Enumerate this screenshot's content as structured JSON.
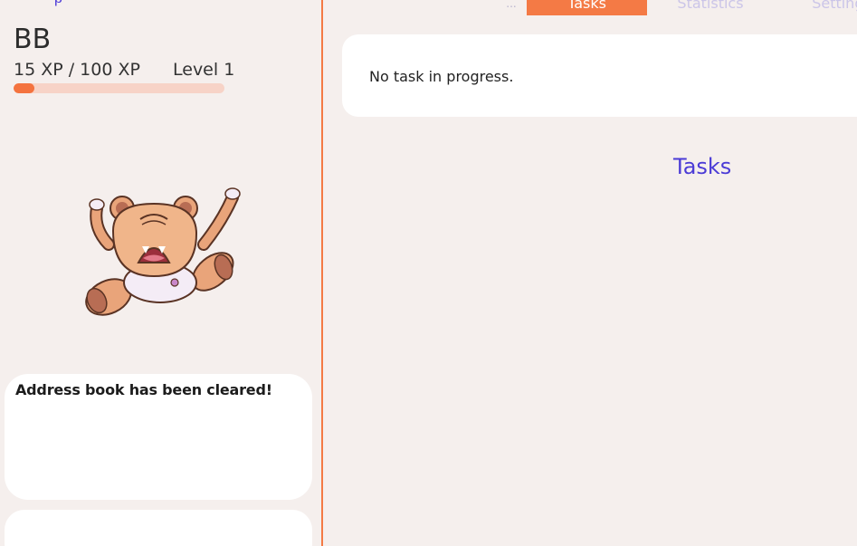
{
  "left_panel": {
    "top_clipped_text": "p",
    "pet_name": "BB",
    "xp_text": "15 XP / 100 XP",
    "level_text": "Level 1",
    "xp_progress": 0.1,
    "pet_image": "angry-bear-icon",
    "message": "Address book has been cleared!",
    "input_value": ""
  },
  "tabs": {
    "more_label": "...",
    "items": [
      {
        "label": "Tasks",
        "active": true
      },
      {
        "label": "Statistics",
        "active": false
      },
      {
        "label": "Settings",
        "active": false
      }
    ]
  },
  "main": {
    "task_status": "No task in progress.",
    "section_heading": "Tasks"
  },
  "colors": {
    "accent": "#f47a45",
    "heading": "#4b3bd6",
    "background": "#f5efed",
    "card": "#ffffff"
  }
}
